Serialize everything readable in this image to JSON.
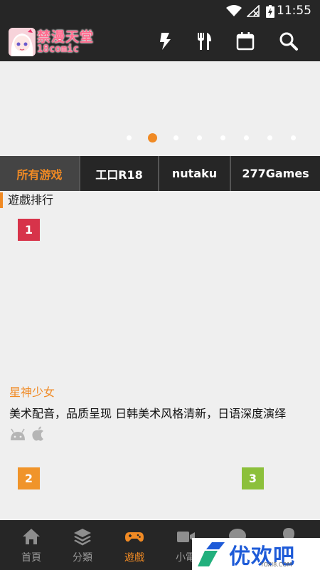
{
  "status_bar": {
    "time": "11:55",
    "icons": [
      "wifi-icon",
      "no-signal-icon",
      "battery-charging-icon"
    ]
  },
  "app_bar": {
    "logo_title": "禁漫天堂",
    "logo_sub": "18comic",
    "actions": [
      "flash-icon",
      "restaurant-icon",
      "calendar-icon",
      "search-icon"
    ]
  },
  "banner": {
    "dot_count": 8,
    "active_dot": 2
  },
  "tabs": [
    {
      "label": "所有游戏",
      "active": true
    },
    {
      "label": "工口R18",
      "active": false
    },
    {
      "label": "nutaku",
      "active": false
    },
    {
      "label": "277Games",
      "active": false
    }
  ],
  "section": {
    "title": "遊戲排行"
  },
  "ranks": [
    {
      "number": "1",
      "color": "#d7334a"
    },
    {
      "number": "2",
      "color": "#f0942a"
    },
    {
      "number": "3",
      "color": "#8cc03b"
    }
  ],
  "game": {
    "name": "星神少女",
    "description": "美术配音，品质呈现 日韩美术风格清新，日语深度演绎",
    "platforms": [
      "android-icon",
      "apple-icon"
    ]
  },
  "bottom_nav": [
    {
      "label": "首頁",
      "icon": "home-icon",
      "active": false
    },
    {
      "label": "分類",
      "icon": "layers-icon",
      "active": false
    },
    {
      "label": "遊戲",
      "icon": "gamepad-icon",
      "active": true
    },
    {
      "label": "小電",
      "icon": "video-icon",
      "active": false
    },
    {
      "label": "",
      "icon": "chat-icon",
      "active": false
    },
    {
      "label": "",
      "icon": "profile-icon",
      "active": false
    }
  ],
  "watermark": {
    "text": "优欢吧",
    "domain": "YOXI8.COM"
  },
  "colors": {
    "accent": "#f08a24",
    "bar": "#262626",
    "background": "#efefef"
  }
}
